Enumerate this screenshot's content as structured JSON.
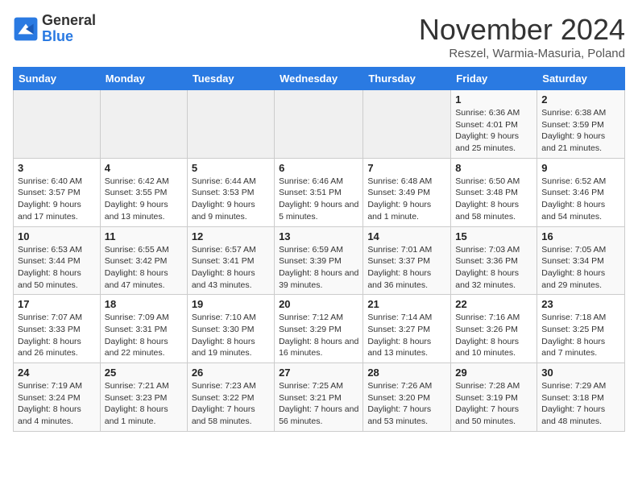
{
  "logo": {
    "text_general": "General",
    "text_blue": "Blue"
  },
  "header": {
    "title": "November 2024",
    "subtitle": "Reszel, Warmia-Masuria, Poland"
  },
  "weekdays": [
    "Sunday",
    "Monday",
    "Tuesday",
    "Wednesday",
    "Thursday",
    "Friday",
    "Saturday"
  ],
  "weeks": [
    [
      {
        "day": "",
        "info": ""
      },
      {
        "day": "",
        "info": ""
      },
      {
        "day": "",
        "info": ""
      },
      {
        "day": "",
        "info": ""
      },
      {
        "day": "",
        "info": ""
      },
      {
        "day": "1",
        "info": "Sunrise: 6:36 AM\nSunset: 4:01 PM\nDaylight: 9 hours and 25 minutes."
      },
      {
        "day": "2",
        "info": "Sunrise: 6:38 AM\nSunset: 3:59 PM\nDaylight: 9 hours and 21 minutes."
      }
    ],
    [
      {
        "day": "3",
        "info": "Sunrise: 6:40 AM\nSunset: 3:57 PM\nDaylight: 9 hours and 17 minutes."
      },
      {
        "day": "4",
        "info": "Sunrise: 6:42 AM\nSunset: 3:55 PM\nDaylight: 9 hours and 13 minutes."
      },
      {
        "day": "5",
        "info": "Sunrise: 6:44 AM\nSunset: 3:53 PM\nDaylight: 9 hours and 9 minutes."
      },
      {
        "day": "6",
        "info": "Sunrise: 6:46 AM\nSunset: 3:51 PM\nDaylight: 9 hours and 5 minutes."
      },
      {
        "day": "7",
        "info": "Sunrise: 6:48 AM\nSunset: 3:49 PM\nDaylight: 9 hours and 1 minute."
      },
      {
        "day": "8",
        "info": "Sunrise: 6:50 AM\nSunset: 3:48 PM\nDaylight: 8 hours and 58 minutes."
      },
      {
        "day": "9",
        "info": "Sunrise: 6:52 AM\nSunset: 3:46 PM\nDaylight: 8 hours and 54 minutes."
      }
    ],
    [
      {
        "day": "10",
        "info": "Sunrise: 6:53 AM\nSunset: 3:44 PM\nDaylight: 8 hours and 50 minutes."
      },
      {
        "day": "11",
        "info": "Sunrise: 6:55 AM\nSunset: 3:42 PM\nDaylight: 8 hours and 47 minutes."
      },
      {
        "day": "12",
        "info": "Sunrise: 6:57 AM\nSunset: 3:41 PM\nDaylight: 8 hours and 43 minutes."
      },
      {
        "day": "13",
        "info": "Sunrise: 6:59 AM\nSunset: 3:39 PM\nDaylight: 8 hours and 39 minutes."
      },
      {
        "day": "14",
        "info": "Sunrise: 7:01 AM\nSunset: 3:37 PM\nDaylight: 8 hours and 36 minutes."
      },
      {
        "day": "15",
        "info": "Sunrise: 7:03 AM\nSunset: 3:36 PM\nDaylight: 8 hours and 32 minutes."
      },
      {
        "day": "16",
        "info": "Sunrise: 7:05 AM\nSunset: 3:34 PM\nDaylight: 8 hours and 29 minutes."
      }
    ],
    [
      {
        "day": "17",
        "info": "Sunrise: 7:07 AM\nSunset: 3:33 PM\nDaylight: 8 hours and 26 minutes."
      },
      {
        "day": "18",
        "info": "Sunrise: 7:09 AM\nSunset: 3:31 PM\nDaylight: 8 hours and 22 minutes."
      },
      {
        "day": "19",
        "info": "Sunrise: 7:10 AM\nSunset: 3:30 PM\nDaylight: 8 hours and 19 minutes."
      },
      {
        "day": "20",
        "info": "Sunrise: 7:12 AM\nSunset: 3:29 PM\nDaylight: 8 hours and 16 minutes."
      },
      {
        "day": "21",
        "info": "Sunrise: 7:14 AM\nSunset: 3:27 PM\nDaylight: 8 hours and 13 minutes."
      },
      {
        "day": "22",
        "info": "Sunrise: 7:16 AM\nSunset: 3:26 PM\nDaylight: 8 hours and 10 minutes."
      },
      {
        "day": "23",
        "info": "Sunrise: 7:18 AM\nSunset: 3:25 PM\nDaylight: 8 hours and 7 minutes."
      }
    ],
    [
      {
        "day": "24",
        "info": "Sunrise: 7:19 AM\nSunset: 3:24 PM\nDaylight: 8 hours and 4 minutes."
      },
      {
        "day": "25",
        "info": "Sunrise: 7:21 AM\nSunset: 3:23 PM\nDaylight: 8 hours and 1 minute."
      },
      {
        "day": "26",
        "info": "Sunrise: 7:23 AM\nSunset: 3:22 PM\nDaylight: 7 hours and 58 minutes."
      },
      {
        "day": "27",
        "info": "Sunrise: 7:25 AM\nSunset: 3:21 PM\nDaylight: 7 hours and 56 minutes."
      },
      {
        "day": "28",
        "info": "Sunrise: 7:26 AM\nSunset: 3:20 PM\nDaylight: 7 hours and 53 minutes."
      },
      {
        "day": "29",
        "info": "Sunrise: 7:28 AM\nSunset: 3:19 PM\nDaylight: 7 hours and 50 minutes."
      },
      {
        "day": "30",
        "info": "Sunrise: 7:29 AM\nSunset: 3:18 PM\nDaylight: 7 hours and 48 minutes."
      }
    ]
  ]
}
